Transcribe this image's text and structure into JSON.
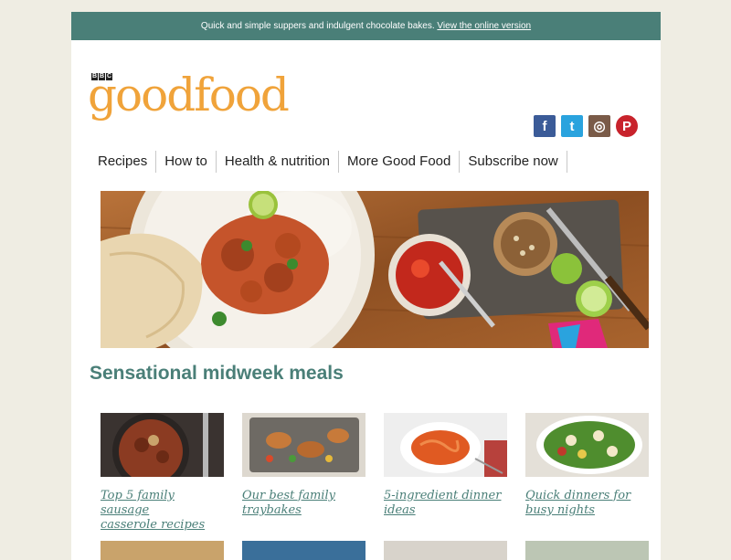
{
  "topbar": {
    "text": "Quick and simple suppers and indulgent chocolate bakes.",
    "link": "View the online version"
  },
  "logo": {
    "bbc": [
      "B",
      "B",
      "C"
    ],
    "text": "goodfood"
  },
  "social": [
    {
      "name": "facebook",
      "glyph": "f"
    },
    {
      "name": "twitter",
      "glyph": "t"
    },
    {
      "name": "instagram",
      "glyph": "◎"
    },
    {
      "name": "pinterest",
      "glyph": "P"
    }
  ],
  "nav": [
    "Recipes",
    "How to",
    "Health & nutrition",
    "More Good Food",
    "Subscribe now"
  ],
  "section": {
    "title": "Sensational midweek meals"
  },
  "cards": [
    {
      "line1": "Top 5 family sausage",
      "line2": "casserole recipes"
    },
    {
      "line1": "Our best family",
      "line2": "traybakes"
    },
    {
      "line1": "5-ingredient dinner",
      "line2": "ideas"
    },
    {
      "line1": "Quick dinners for",
      "line2": "busy nights"
    }
  ],
  "colors": {
    "teal": "#4a7f78",
    "orange": "#f0a33a",
    "page": "#efede3"
  }
}
